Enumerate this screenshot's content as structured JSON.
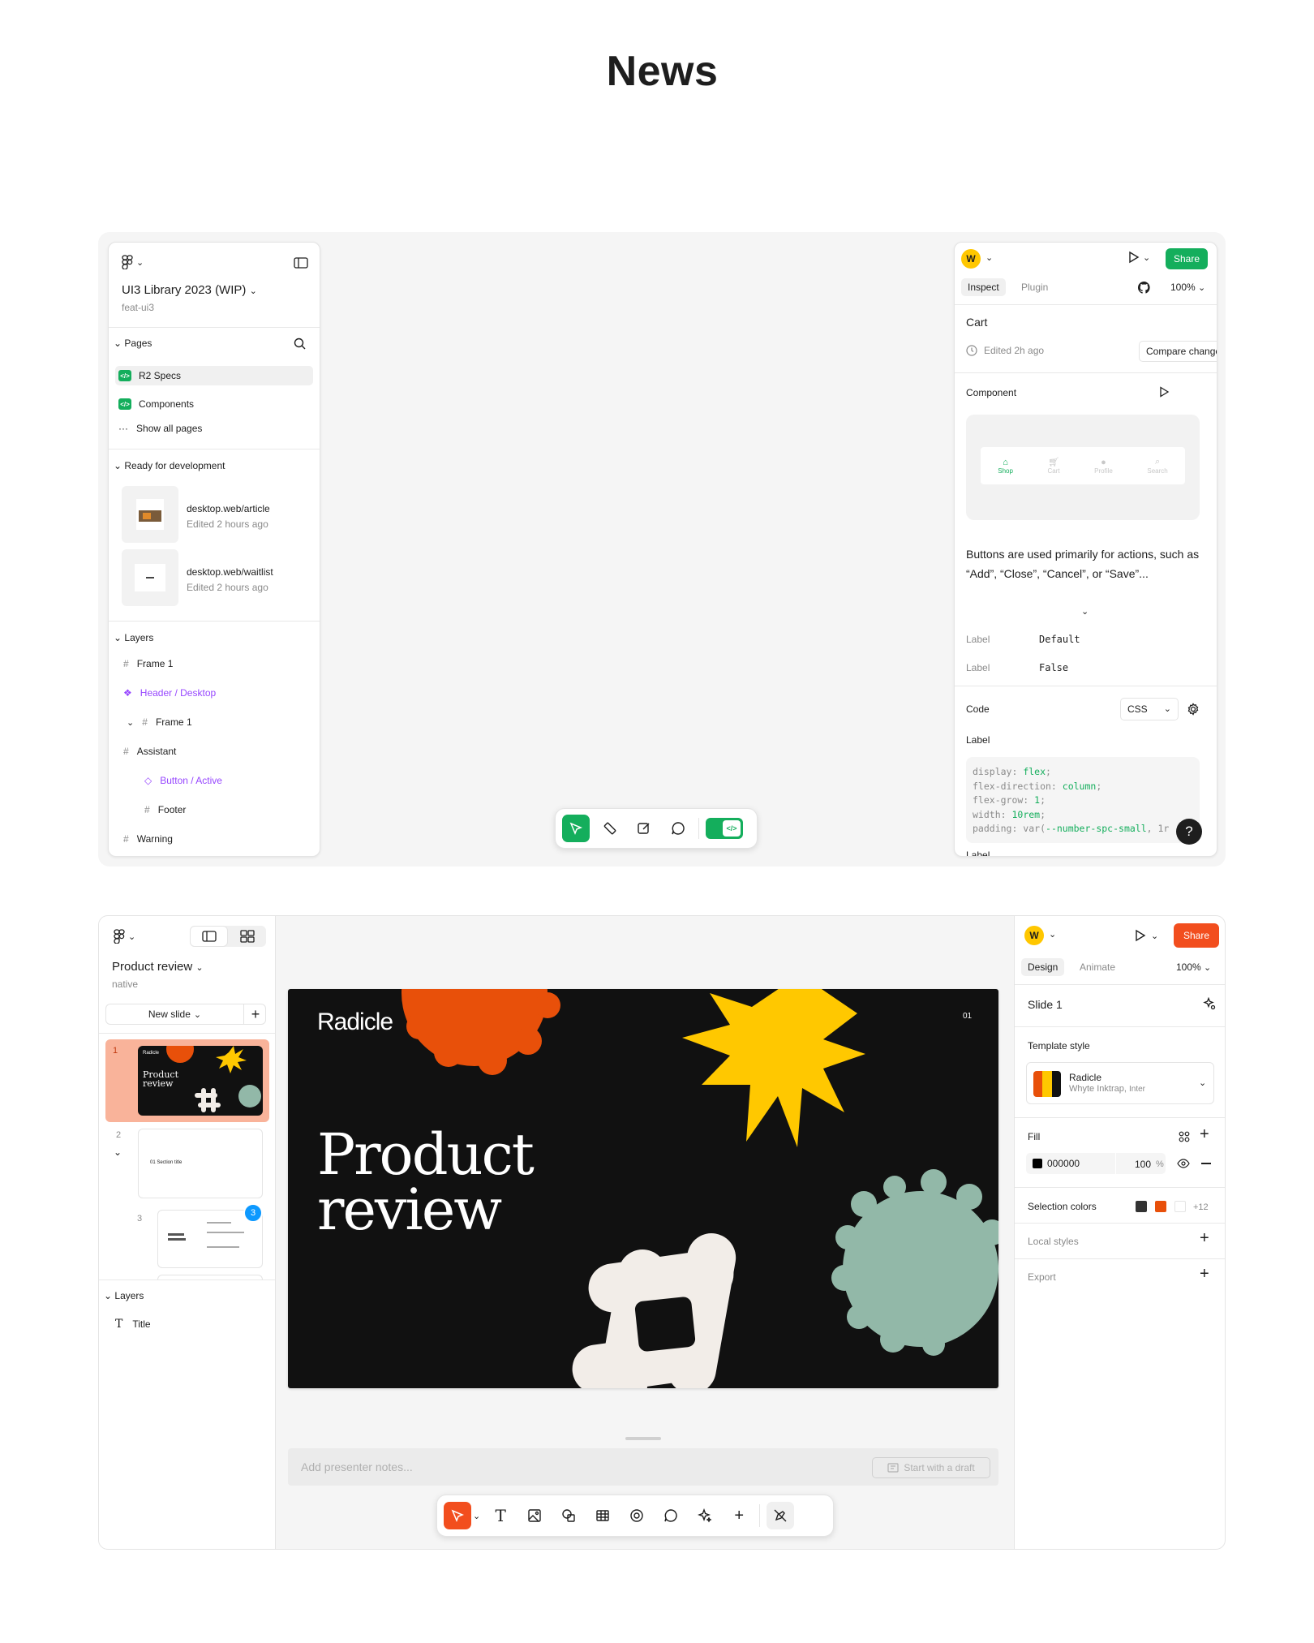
{
  "page": {
    "title": "News"
  },
  "shot1": {
    "left": {
      "file_title": "UI3 Library 2023 (WIP)",
      "branch": "feat-ui3",
      "pages_header": "Pages",
      "pages": [
        "R2 Specs",
        "Components"
      ],
      "show_all": "Show all pages",
      "ready_header": "Ready for development",
      "ready_items": [
        {
          "name": "desktop.web/article",
          "time": "Edited 2 hours ago"
        },
        {
          "name": "desktop.web/waitlist",
          "time": "Edited 2 hours ago"
        }
      ],
      "layers_header": "Layers",
      "layers": [
        "Frame 1",
        "Header / Desktop",
        "Frame 1",
        "Assistant",
        "Button / Active",
        "Footer",
        "Warning"
      ]
    },
    "right": {
      "avatar": "W",
      "share": "Share",
      "tab_inspect": "Inspect",
      "tab_plugin": "Plugin",
      "zoom": "100%",
      "item_title": "Cart",
      "edited": "Edited 2h ago",
      "compare": "Compare changes",
      "component_header": "Component",
      "preview_tabs": [
        "Shop",
        "Cart",
        "Profile",
        "Search"
      ],
      "description": "Buttons are used primarily for actions, such as “Add”, “Close”, “Cancel”, or “Save”...",
      "props": [
        {
          "label": "Label",
          "value": "Default"
        },
        {
          "label": "Label",
          "value": "False"
        }
      ],
      "code_header": "Code",
      "code_lang": "CSS",
      "code_label": "Label",
      "code_lines": [
        {
          "prop": "display: ",
          "val": "flex",
          "end": ";"
        },
        {
          "prop": "flex-direction: ",
          "val": "column",
          "end": ";"
        },
        {
          "prop": "flex-grow: ",
          "val": "1",
          "end": ";"
        },
        {
          "prop": "width: ",
          "val": "10rem",
          "end": ";"
        },
        {
          "prop": "padding: var(",
          "val": "--number-spc-small",
          "end": ", 1r"
        }
      ],
      "help": "?",
      "bottom_label": "Label"
    },
    "colors": {
      "accent": "#14ae5c",
      "component": "#9747ff"
    }
  },
  "shot2": {
    "left": {
      "file_title": "Product review",
      "branch": "native",
      "new_slide": "New slide",
      "slide_numbers": [
        "1",
        "2",
        "3"
      ],
      "thumb1_brand": "Radicle",
      "thumb1_title": "Product review",
      "thumb2_text": "01   Section title",
      "thumb3_badge": "3",
      "layers_header": "Layers",
      "layers": [
        "Title"
      ]
    },
    "slide": {
      "brand": "Radicle",
      "number": "01",
      "title_line1": "Product",
      "title_line2": "review"
    },
    "notes_placeholder": "Add presenter notes...",
    "draft_button": "Start with a draft",
    "right": {
      "avatar": "W",
      "share": "Share",
      "tab_design": "Design",
      "tab_animate": "Animate",
      "zoom": "100%",
      "slide_title": "Slide 1",
      "template_header": "Template style",
      "template_name": "Radicle",
      "template_fonts": "Whyte Inktrap,",
      "template_font2": "Inter",
      "fill_header": "Fill",
      "fill_hex": "000000",
      "fill_opacity": "100",
      "fill_pct": "%",
      "selection_colors": "Selection colors",
      "selection_more": "+12",
      "local_styles": "Local styles",
      "export": "Export"
    },
    "colors": {
      "accent": "#f24e1e",
      "slide_bg": "#111111",
      "orange": "#e8500a",
      "yellow": "#ffc800",
      "teal": "#92b8a8",
      "cream": "#f2ede8"
    }
  }
}
